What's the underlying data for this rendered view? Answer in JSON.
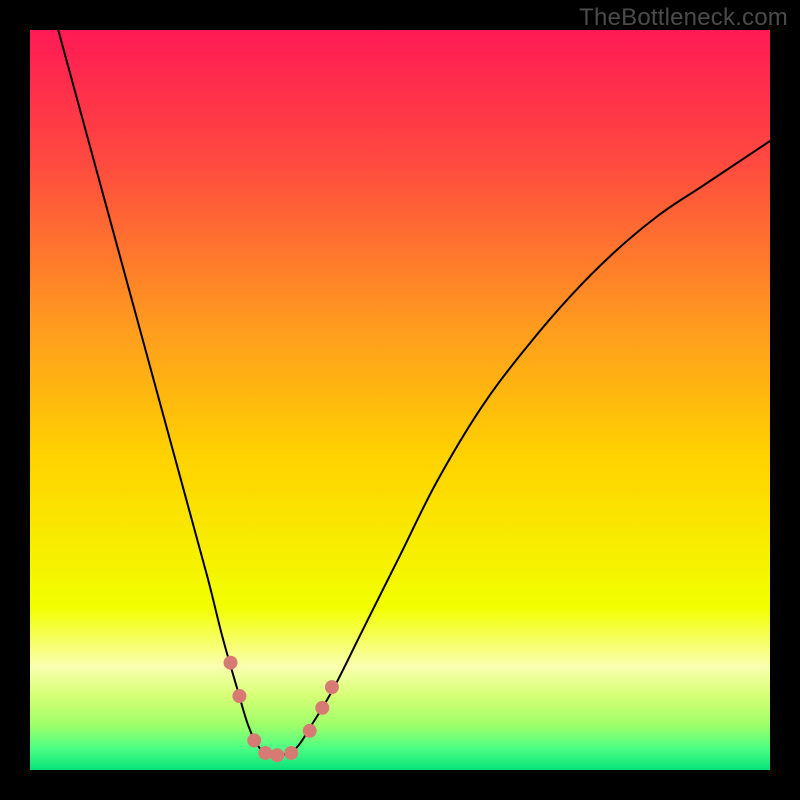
{
  "watermark": "TheBottleneck.com",
  "chart_data": {
    "type": "line",
    "title": "",
    "xlabel": "",
    "ylabel": "",
    "xlim": [
      0,
      100
    ],
    "ylim": [
      0,
      100
    ],
    "grid": false,
    "legend": false,
    "background_gradient": {
      "stops": [
        {
          "offset": 0.0,
          "color": "#ff1a55"
        },
        {
          "offset": 0.18,
          "color": "#ff4a3f"
        },
        {
          "offset": 0.4,
          "color": "#ff9b1f"
        },
        {
          "offset": 0.58,
          "color": "#ffd300"
        },
        {
          "offset": 0.78,
          "color": "#f2ff00"
        },
        {
          "offset": 0.86,
          "color": "#faffb0"
        },
        {
          "offset": 0.9,
          "color": "#d6ff75"
        },
        {
          "offset": 0.94,
          "color": "#9dff6a"
        },
        {
          "offset": 0.97,
          "color": "#4eff84"
        },
        {
          "offset": 1.0,
          "color": "#07e27a"
        }
      ]
    },
    "series": [
      {
        "name": "bottleneck-curve",
        "stroke": "#000000",
        "stroke_width": 2,
        "x": [
          3,
          6,
          9,
          12,
          15,
          18,
          21,
          24,
          26,
          28,
          29.5,
          31,
          32.5,
          34,
          36,
          38,
          41,
          45,
          50,
          55,
          61,
          67,
          73,
          79,
          85,
          91,
          97,
          100
        ],
        "y": [
          103,
          92,
          81,
          70,
          59,
          48,
          37,
          26,
          18,
          11,
          6,
          3,
          2,
          2,
          3,
          6,
          11,
          19,
          29,
          39,
          49,
          57,
          64,
          70,
          75,
          79,
          83,
          85
        ]
      }
    ],
    "markers": {
      "name": "highlight-dots",
      "color": "#d87a74",
      "radius": 7,
      "points": [
        {
          "x": 27.1,
          "y": 14.5
        },
        {
          "x": 28.3,
          "y": 10.0
        },
        {
          "x": 30.3,
          "y": 4.0
        },
        {
          "x": 31.8,
          "y": 2.3
        },
        {
          "x": 33.4,
          "y": 2.0
        },
        {
          "x": 35.3,
          "y": 2.3
        },
        {
          "x": 37.8,
          "y": 5.3
        },
        {
          "x": 39.5,
          "y": 8.4
        },
        {
          "x": 40.8,
          "y": 11.2
        }
      ]
    }
  }
}
